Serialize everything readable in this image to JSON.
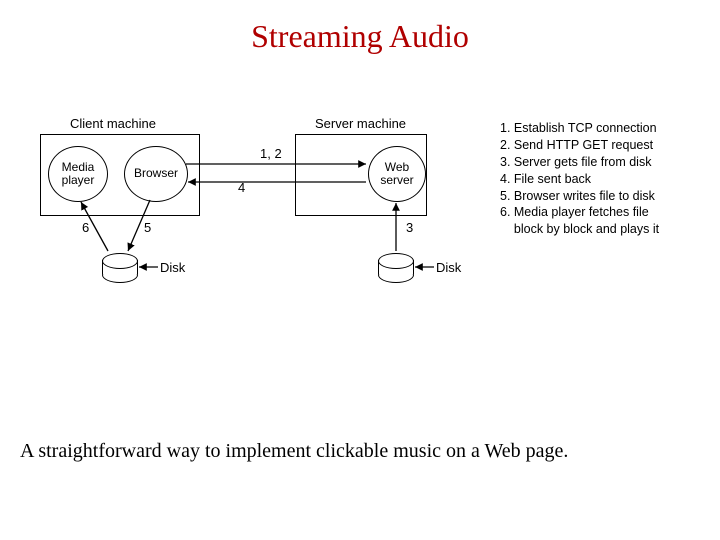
{
  "title": "Streaming Audio",
  "caption": "A straightforward way to implement clickable music on a Web page.",
  "client_label": "Client machine",
  "server_label": "Server machine",
  "media_player": "Media\nplayer",
  "browser": "Browser",
  "web_server": "Web\nserver",
  "disk_label_left": "Disk",
  "disk_label_right": "Disk",
  "edge_12": "1, 2",
  "edge_3": "3",
  "edge_4": "4",
  "edge_5": "5",
  "edge_6": "6",
  "steps": {
    "s1": "1. Establish TCP connection",
    "s2": "2. Send HTTP GET request",
    "s3": "3. Server gets file from disk",
    "s4": "4. File sent back",
    "s5": "5. Browser writes file to disk",
    "s6a": "6. Media player fetches file",
    "s6b": "    block by block and plays it"
  }
}
